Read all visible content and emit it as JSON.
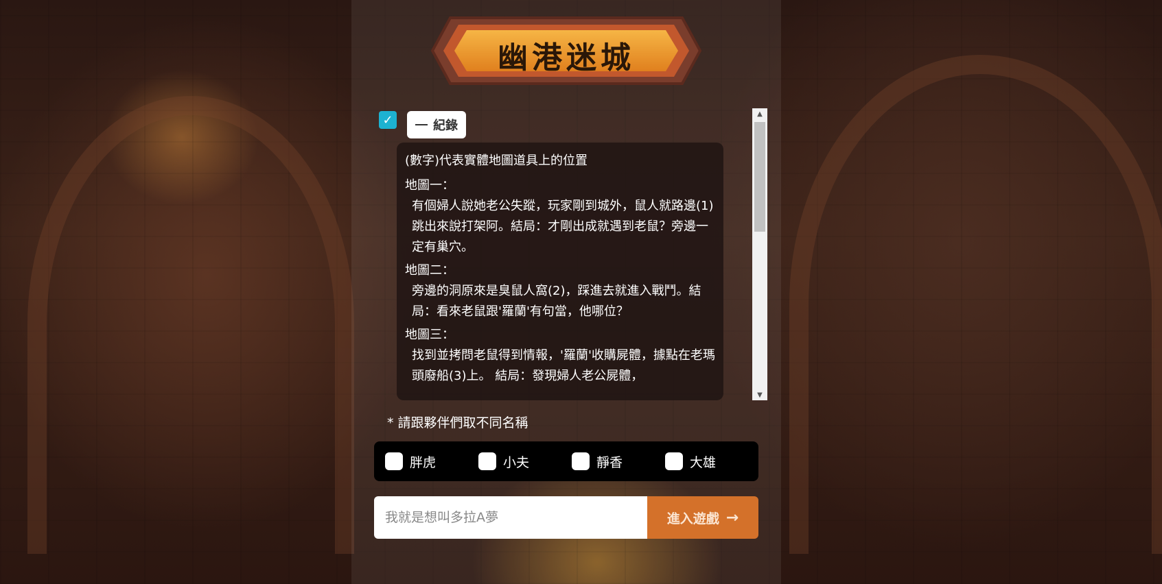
{
  "logo": {
    "title": "幽港迷城"
  },
  "record": {
    "toggle_label": "紀錄",
    "intro": "(數字)代表實體地圖道具上的位置",
    "maps": [
      {
        "title": "地圖一：",
        "body": "有個婦人說她老公失蹤，玩家剛到城外，鼠人就路邊(1)跳出來說打架阿。結局：才剛出成就遇到老鼠？旁邊一定有巢穴。"
      },
      {
        "title": "地圖二：",
        "body": "旁邊的洞原來是臭鼠人窩(2)，踩進去就進入戰鬥。結局：看來老鼠跟'羅蘭'有句當，他哪位？"
      },
      {
        "title": "地圖三：",
        "body": "找到並拷問老鼠得到情報，'羅蘭'收購屍體，據點在老瑪頭廢船(3)上。 結局：發現婦人老公屍體，"
      }
    ]
  },
  "hint": "* 請跟夥伴們取不同名稱",
  "options": [
    "胖虎",
    "小夫",
    "靜香",
    "大雄"
  ],
  "name_input": {
    "placeholder": "我就是想叫多拉A夢",
    "value": ""
  },
  "enter_button": {
    "label": "進入遊戲"
  },
  "colors": {
    "accent_check": "#1db2d1",
    "enter_button": "#d4712a"
  }
}
